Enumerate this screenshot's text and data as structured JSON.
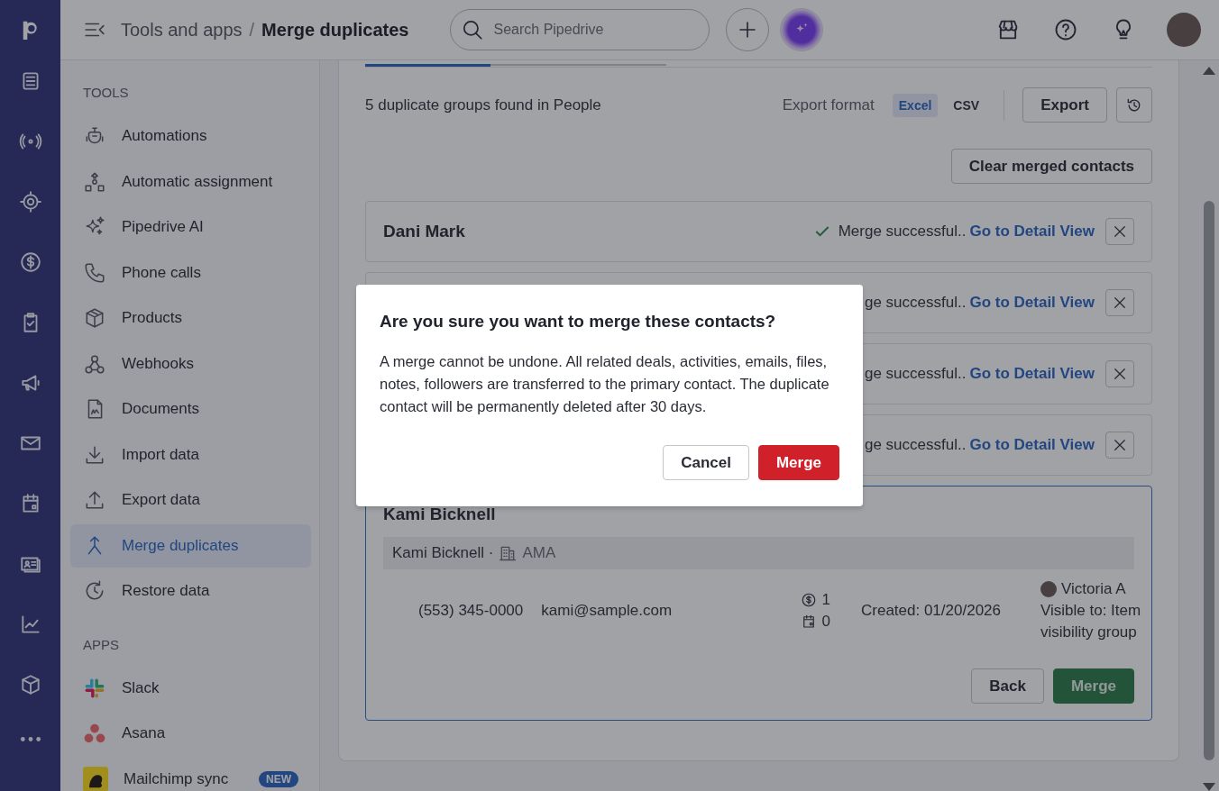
{
  "header": {
    "breadcrumb": [
      "Tools and apps",
      "Merge duplicates"
    ],
    "separator": "/",
    "search": {
      "placeholder": "Search Pipedrive"
    }
  },
  "sidebar": {
    "sections": [
      {
        "heading": "TOOLS",
        "items": [
          {
            "label": "Automations",
            "selected": false
          },
          {
            "label": "Automatic assignment",
            "selected": false
          },
          {
            "label": "Pipedrive AI",
            "selected": false
          },
          {
            "label": "Phone calls",
            "selected": false
          },
          {
            "label": "Products",
            "selected": false
          },
          {
            "label": "Webhooks",
            "selected": false
          },
          {
            "label": "Documents",
            "selected": false
          },
          {
            "label": "Import data",
            "selected": false
          },
          {
            "label": "Export data",
            "selected": false
          },
          {
            "label": "Merge duplicates",
            "selected": true
          },
          {
            "label": "Restore data",
            "selected": false
          }
        ]
      },
      {
        "heading": "APPS",
        "items": [
          {
            "label": "Slack",
            "selected": false
          },
          {
            "label": "Asana",
            "selected": false
          },
          {
            "label": "Mailchimp sync",
            "selected": false,
            "badge": "NEW"
          }
        ]
      }
    ]
  },
  "content": {
    "summary": "5 duplicate groups found in People",
    "export": {
      "label": "Export format",
      "formats": [
        {
          "label": "Excel",
          "selected": true
        },
        {
          "label": "CSV",
          "selected": false
        }
      ],
      "button": "Export"
    },
    "clear_button": "Clear merged contacts",
    "groups": [
      {
        "name": "Dani Mark",
        "status": "Merge successful..",
        "link": "Go to Detail View"
      },
      {
        "status": "ge successful..",
        "link": "Go to Detail View"
      },
      {
        "status": "ge successful..",
        "link": "Go to Detail View"
      },
      {
        "status": "ge successful..",
        "link": "Go to Detail View"
      }
    ],
    "open_group": {
      "name": "Kami Bicknell",
      "contact": "Kami Bicknell ·",
      "organization": "AMA",
      "phone": "(553) 345-0000",
      "email": "kami@sample.com",
      "deals": "1",
      "activities": "0",
      "created": "Created: 01/20/2026",
      "owner": "Victoria A",
      "visibility": [
        "Visible to: Item",
        "visibility group"
      ],
      "buttons": [
        "Back",
        "Merge"
      ]
    }
  },
  "modal": {
    "title": "Are you sure you want to merge these contacts?",
    "body": "A merge cannot be undone. All related deals, activities, emails, files, notes, followers are transferred to the primary contact. The duplicate contact will be permanently deleted after 30 days.",
    "cancel": "Cancel",
    "confirm": "Merge"
  }
}
